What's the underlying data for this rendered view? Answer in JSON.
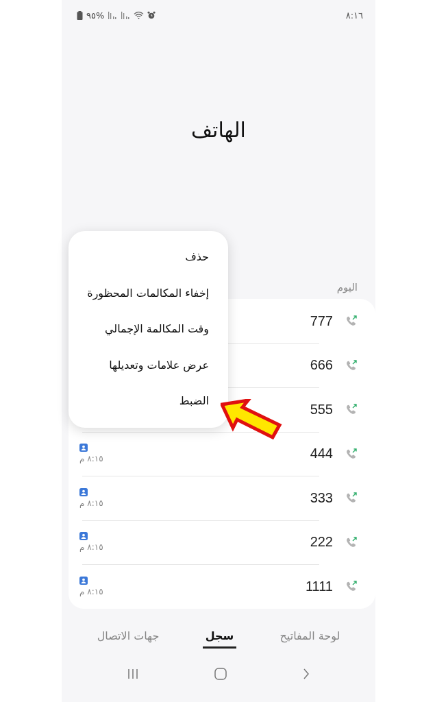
{
  "status_bar": {
    "time": "٨:١٦",
    "battery": "%٩٥"
  },
  "title": "الهاتف",
  "section": "اليوم",
  "calls": [
    {
      "number": "777"
    },
    {
      "number": "666"
    },
    {
      "number": "555"
    },
    {
      "number": "444",
      "time": "٨:١٥ م"
    },
    {
      "number": "333",
      "time": "٨:١٥ م"
    },
    {
      "number": "222",
      "time": "٨:١٥ م"
    },
    {
      "number": "1111",
      "time": "٨:١٥ م"
    }
  ],
  "menu": [
    "حذف",
    "إخفاء المكالمات المحظورة",
    "وقت المكالمة الإجمالي",
    "عرض علامات وتعديلها",
    "الضبط"
  ],
  "tabs": [
    {
      "label": "لوحة المفاتيح",
      "selected": false
    },
    {
      "label": "سجل",
      "selected": true
    },
    {
      "label": "جهات الاتصال",
      "selected": false
    }
  ]
}
